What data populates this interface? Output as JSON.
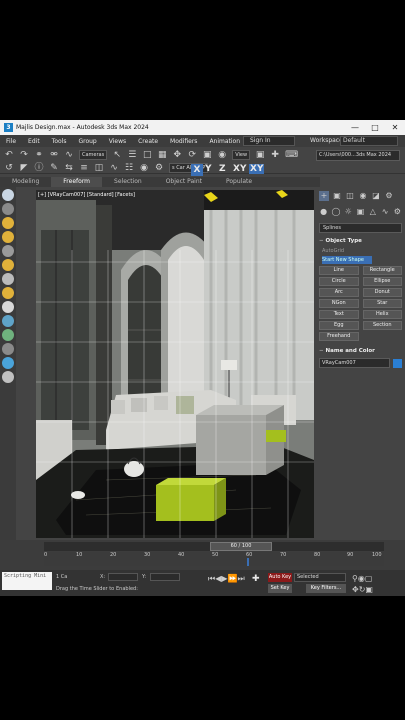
{
  "window": {
    "title": "Majlis Design.max - Autodesk 3ds Max 2024",
    "minimize": "—",
    "maximize": "□",
    "close": "✕"
  },
  "menu": [
    "File",
    "Edit",
    "Tools",
    "Group",
    "Views",
    "Create",
    "Modifiers",
    "Animation"
  ],
  "signin": "Sign In",
  "workspaces": {
    "label": "Workspaces",
    "value": "Default"
  },
  "toolbar": {
    "cameras": "Cameras",
    "view": "View",
    "axis_x": "X",
    "axis_y": "Y",
    "axis_z": "Z",
    "axis_xy": "XY",
    "axis_xy2": "XY",
    "constraint": "s Car Along P",
    "project_path": "C:\\Users\\000...3ds Max 2024"
  },
  "ribbon": {
    "tabs": [
      "Modeling",
      "Freeform",
      "Selection",
      "Object Paint",
      "Populate"
    ],
    "active": "Freeform"
  },
  "viewport": {
    "label": "[+] [VRayCam007] [Standard] [Facets]"
  },
  "command_panel": {
    "category": "Splines",
    "object_type_title": "Object Type",
    "autogrid": "AutoGrid",
    "start_new_shape": "Start New Shape",
    "buttons": [
      "Line",
      "Rectangle",
      "Circle",
      "Ellipse",
      "Arc",
      "Donut",
      "NGon",
      "Star",
      "Text",
      "Helix",
      "Egg",
      "Section",
      "Freehand"
    ],
    "name_color_title": "Name and Color",
    "object_name": "VRayCam007",
    "object_color": "#2a7fd4"
  },
  "timeline": {
    "frame_display": "60 / 100",
    "current_frame": 60,
    "total_frames": 100,
    "ticks": [
      "0",
      "10",
      "20",
      "30",
      "40",
      "50",
      "60",
      "70",
      "80",
      "90",
      "100"
    ]
  },
  "status": {
    "script_label": "Scripting Mini",
    "selection_count": "1 Ca",
    "x_label": "X:",
    "y_label": "Y:",
    "hint": "Drag the Time Slider to",
    "enabled_label": "Enabled:",
    "auto_key": "Auto Key",
    "selected": "Selected",
    "set_key": "Set Key",
    "key_filters": "Key Filters..."
  }
}
